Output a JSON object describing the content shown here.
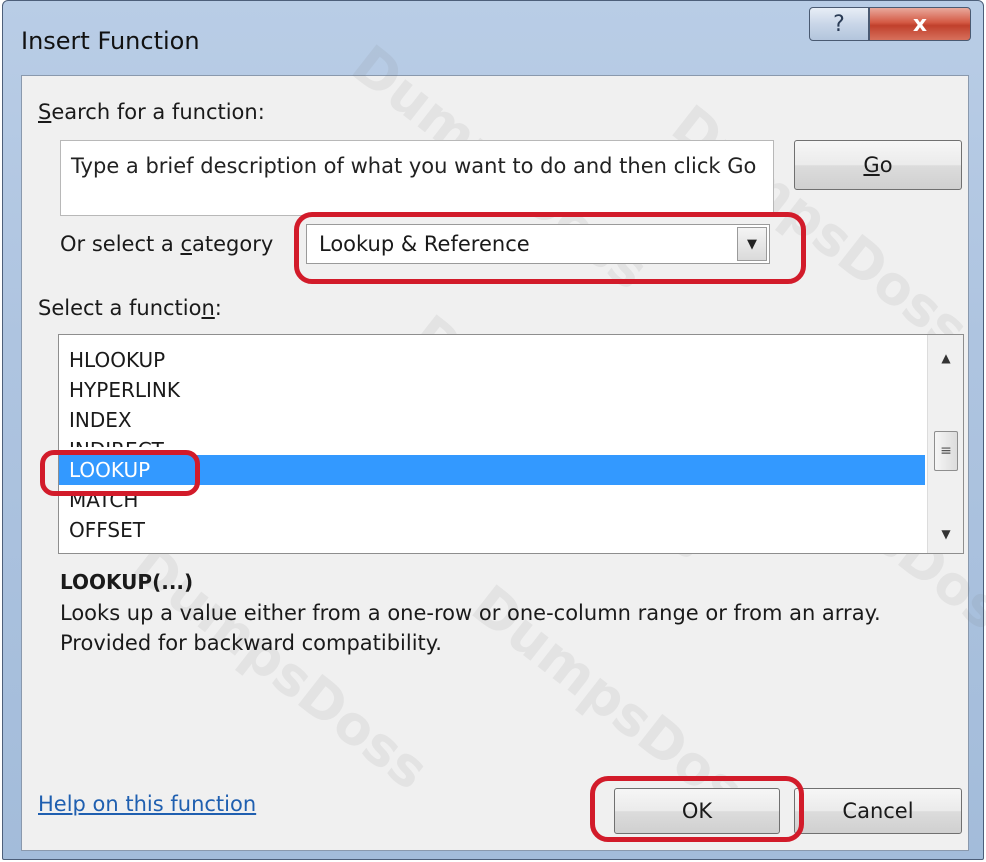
{
  "window": {
    "title": "Insert Function",
    "help_glyph": "?",
    "close_glyph": "x"
  },
  "search": {
    "label_prefix": "",
    "label_accel": "S",
    "label_rest": "earch for a function:",
    "placeholder": "Type a brief description of what you want to do and then click Go",
    "go_label_accel": "G",
    "go_label_rest": "o"
  },
  "category": {
    "label_before": "Or select a ",
    "label_accel": "c",
    "label_after": "ategory",
    "selected": "Lookup & Reference",
    "arrow_glyph": "▼"
  },
  "functions": {
    "label_before": "Select a functio",
    "label_accel": "n",
    "label_after": ":",
    "items": [
      {
        "label": "HLOOKUP"
      },
      {
        "label": "HYPERLINK"
      },
      {
        "label": "INDEX"
      },
      {
        "label": "INDIRECT"
      },
      {
        "label": "LOOKUP"
      },
      {
        "label": "MATCH"
      },
      {
        "label": "OFFSET"
      }
    ],
    "selected_index": 4,
    "scroll": {
      "up_glyph": "▲",
      "down_glyph": "▼",
      "thumb_glyph": "≡"
    }
  },
  "details": {
    "signature": "LOOKUP(...)",
    "description": "Looks up a value either from a one-row or one-column range or from an array. Provided for backward compatibility."
  },
  "footer": {
    "help_link": "Help on this function",
    "ok_label": "OK",
    "cancel_label": "Cancel"
  },
  "watermark_text": "DumpsDoss",
  "colors": {
    "selection": "#3399ff",
    "annotation": "#d21b2a",
    "link": "#1f5fb0"
  }
}
